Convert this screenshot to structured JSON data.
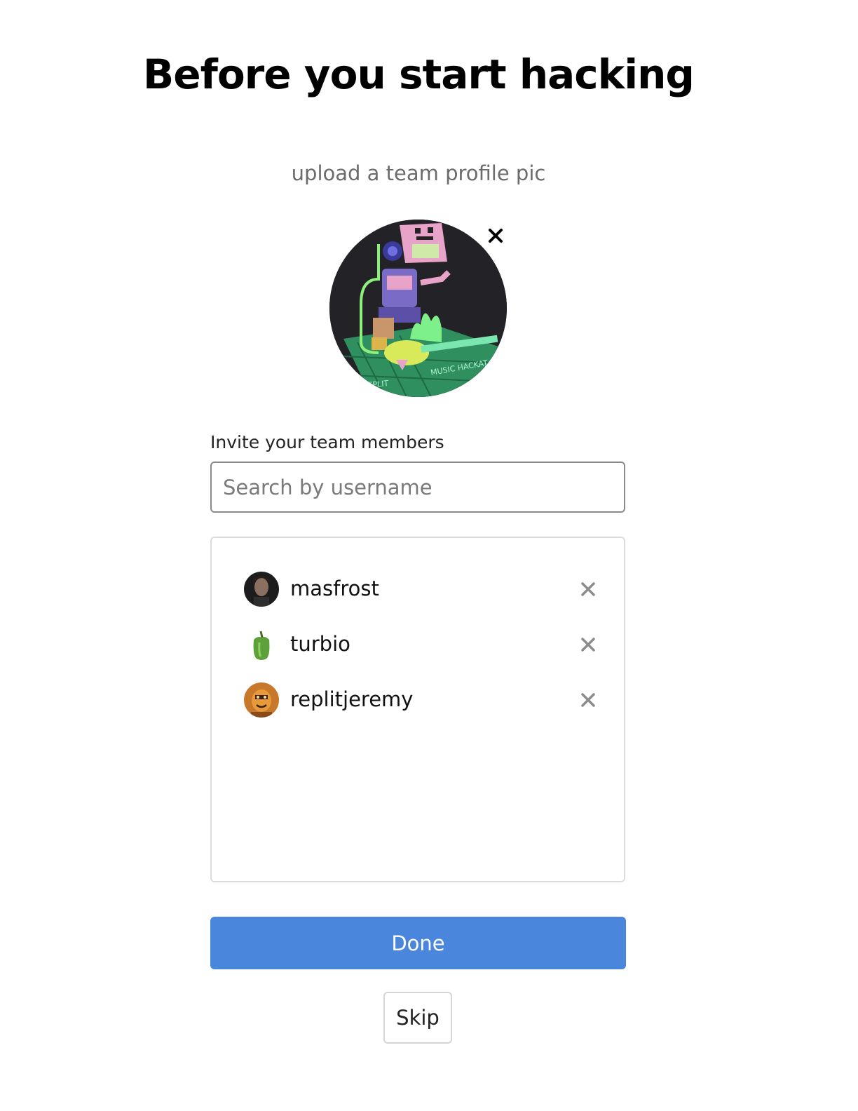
{
  "header": {
    "title": "Before you start hacking",
    "upload_label": "upload a team profile pic"
  },
  "profile_pic": {
    "icon": "robot-guitar-team-avatar",
    "remove_icon": "close-icon"
  },
  "invite": {
    "label": "Invite your team members",
    "search_value": "",
    "search_placeholder": "Search by username"
  },
  "members": [
    {
      "username": "masfrost",
      "avatar": "person-avatar",
      "remove_icon": "close-icon"
    },
    {
      "username": "turbio",
      "avatar": "green-pepper-avatar",
      "remove_icon": "close-icon"
    },
    {
      "username": "replitjeremy",
      "avatar": "orange-character-avatar",
      "remove_icon": "close-icon"
    }
  ],
  "actions": {
    "done_label": "Done",
    "skip_label": "Skip"
  },
  "colors": {
    "primary": "#4a86dc",
    "text": "#111111",
    "muted": "#6b6b6b",
    "border": "#8a8a8a",
    "remove_x": "#8c8c8c"
  }
}
